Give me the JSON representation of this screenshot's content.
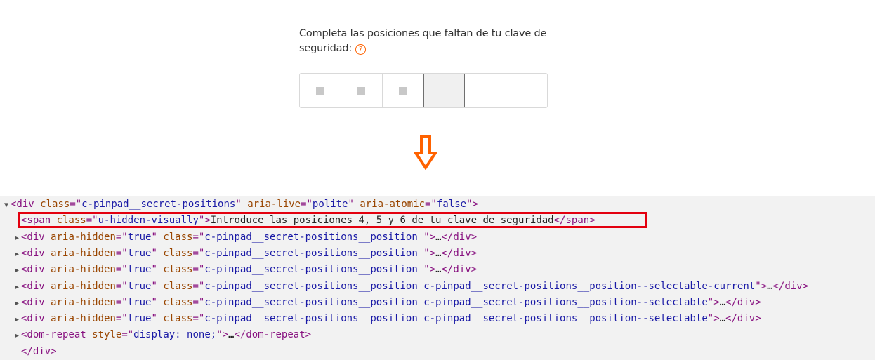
{
  "prompt": {
    "line1": "Completa las posiciones que faltan de tu clave de",
    "line2": "seguridad:",
    "help_icon_glyph": "?"
  },
  "pinpad": {
    "positions": [
      {
        "state": "filled"
      },
      {
        "state": "filled"
      },
      {
        "state": "filled"
      },
      {
        "state": "current"
      },
      {
        "state": "empty"
      },
      {
        "state": "empty"
      }
    ]
  },
  "arrow": {
    "icon": "down-arrow-icon",
    "color": "#ff6200"
  },
  "devtools": {
    "lines": [
      {
        "indent": 0,
        "toggle": "▼",
        "parts": [
          [
            "tag",
            "<div "
          ],
          [
            "attr",
            "class"
          ],
          [
            "tag",
            "=\""
          ],
          [
            "val",
            "c-pinpad__secret-positions"
          ],
          [
            "tag",
            "\" "
          ],
          [
            "attr",
            "aria-live"
          ],
          [
            "tag",
            "=\""
          ],
          [
            "val",
            "polite"
          ],
          [
            "tag",
            "\" "
          ],
          [
            "attr",
            "aria-atomic"
          ],
          [
            "tag",
            "=\""
          ],
          [
            "val",
            "false"
          ],
          [
            "tag",
            "\">"
          ]
        ]
      },
      {
        "indent": 1,
        "toggle": "",
        "parts": [
          [
            "tag",
            "<span "
          ],
          [
            "attr",
            "class"
          ],
          [
            "tag",
            "=\""
          ],
          [
            "val",
            "u-hidden-visually"
          ],
          [
            "tag",
            "\">"
          ],
          [
            "txt",
            "Introduce las posiciones 4, 5 y 6 de tu clave de seguridad"
          ],
          [
            "tag",
            "</span>"
          ]
        ]
      },
      {
        "indent": 1,
        "toggle": "▶",
        "parts": [
          [
            "tag",
            "<div "
          ],
          [
            "attr",
            "aria-hidden"
          ],
          [
            "tag",
            "=\""
          ],
          [
            "val",
            "true"
          ],
          [
            "tag",
            "\" "
          ],
          [
            "attr",
            "class"
          ],
          [
            "tag",
            "=\""
          ],
          [
            "val",
            "c-pinpad__secret-positions__position "
          ],
          [
            "tag",
            "\">"
          ],
          [
            "txt",
            "…"
          ],
          [
            "tag",
            "</div>"
          ]
        ]
      },
      {
        "indent": 1,
        "toggle": "▶",
        "parts": [
          [
            "tag",
            "<div "
          ],
          [
            "attr",
            "aria-hidden"
          ],
          [
            "tag",
            "=\""
          ],
          [
            "val",
            "true"
          ],
          [
            "tag",
            "\" "
          ],
          [
            "attr",
            "class"
          ],
          [
            "tag",
            "=\""
          ],
          [
            "val",
            "c-pinpad__secret-positions__position "
          ],
          [
            "tag",
            "\">"
          ],
          [
            "txt",
            "…"
          ],
          [
            "tag",
            "</div>"
          ]
        ]
      },
      {
        "indent": 1,
        "toggle": "▶",
        "parts": [
          [
            "tag",
            "<div "
          ],
          [
            "attr",
            "aria-hidden"
          ],
          [
            "tag",
            "=\""
          ],
          [
            "val",
            "true"
          ],
          [
            "tag",
            "\" "
          ],
          [
            "attr",
            "class"
          ],
          [
            "tag",
            "=\""
          ],
          [
            "val",
            "c-pinpad__secret-positions__position "
          ],
          [
            "tag",
            "\">"
          ],
          [
            "txt",
            "…"
          ],
          [
            "tag",
            "</div>"
          ]
        ]
      },
      {
        "indent": 1,
        "toggle": "▶",
        "parts": [
          [
            "tag",
            "<div "
          ],
          [
            "attr",
            "aria-hidden"
          ],
          [
            "tag",
            "=\""
          ],
          [
            "val",
            "true"
          ],
          [
            "tag",
            "\" "
          ],
          [
            "attr",
            "class"
          ],
          [
            "tag",
            "=\""
          ],
          [
            "val",
            "c-pinpad__secret-positions__position c-pinpad__secret-positions__position--selectable-current"
          ],
          [
            "tag",
            "\">"
          ],
          [
            "txt",
            "…"
          ],
          [
            "tag",
            "</div>"
          ]
        ]
      },
      {
        "indent": 1,
        "toggle": "▶",
        "parts": [
          [
            "tag",
            "<div "
          ],
          [
            "attr",
            "aria-hidden"
          ],
          [
            "tag",
            "=\""
          ],
          [
            "val",
            "true"
          ],
          [
            "tag",
            "\" "
          ],
          [
            "attr",
            "class"
          ],
          [
            "tag",
            "=\""
          ],
          [
            "val",
            "c-pinpad__secret-positions__position c-pinpad__secret-positions__position--selectable"
          ],
          [
            "tag",
            "\">"
          ],
          [
            "txt",
            "…"
          ],
          [
            "tag",
            "</div>"
          ]
        ]
      },
      {
        "indent": 1,
        "toggle": "▶",
        "parts": [
          [
            "tag",
            "<div "
          ],
          [
            "attr",
            "aria-hidden"
          ],
          [
            "tag",
            "=\""
          ],
          [
            "val",
            "true"
          ],
          [
            "tag",
            "\" "
          ],
          [
            "attr",
            "class"
          ],
          [
            "tag",
            "=\""
          ],
          [
            "val",
            "c-pinpad__secret-positions__position c-pinpad__secret-positions__position--selectable"
          ],
          [
            "tag",
            "\">"
          ],
          [
            "txt",
            "…"
          ],
          [
            "tag",
            "</div>"
          ]
        ]
      },
      {
        "indent": 1,
        "toggle": "▶",
        "parts": [
          [
            "tag",
            "<dom-repeat "
          ],
          [
            "attr",
            "style"
          ],
          [
            "tag",
            "=\""
          ],
          [
            "val",
            "display: none;"
          ],
          [
            "tag",
            "\">"
          ],
          [
            "txt",
            "…"
          ],
          [
            "tag",
            "</dom-repeat>"
          ]
        ]
      },
      {
        "indent": 1,
        "toggle": "",
        "parts": [
          [
            "tag",
            "</div>"
          ]
        ]
      }
    ]
  }
}
